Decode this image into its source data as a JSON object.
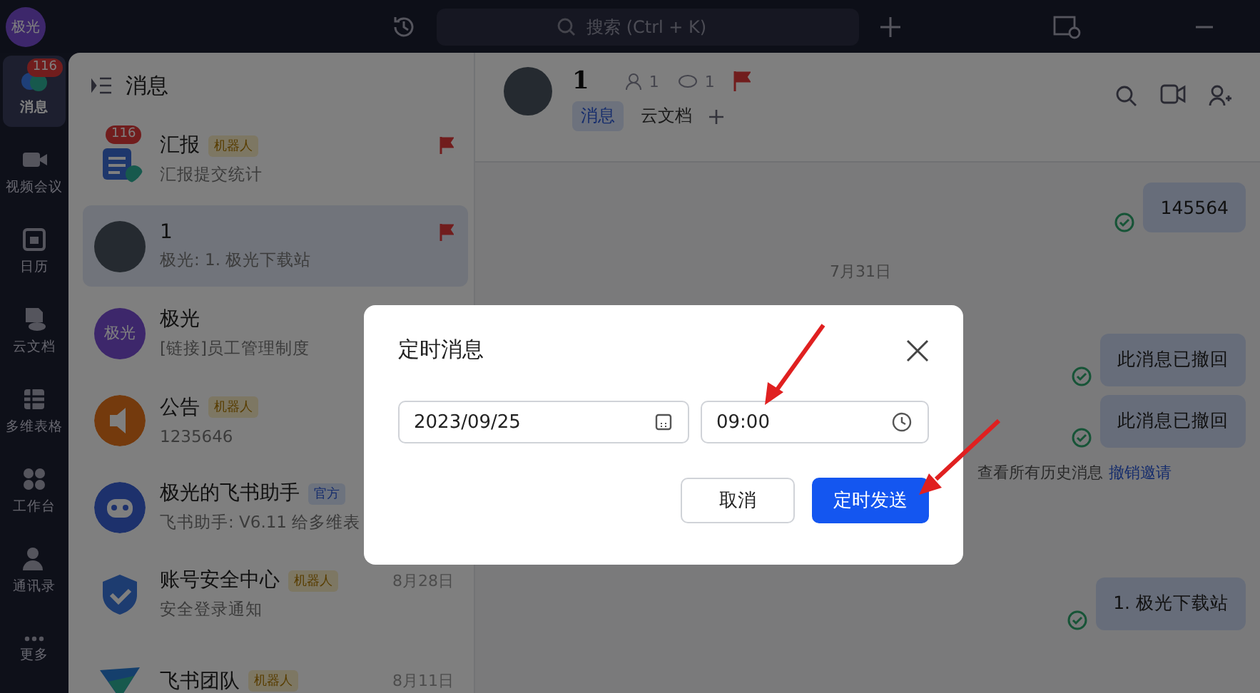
{
  "topbar": {
    "avatar": "极光",
    "search": {
      "placeholder": "搜索 (Ctrl + K)"
    }
  },
  "rail": [
    {
      "label": "消息",
      "kind": "chat",
      "badge": "116",
      "selected": true
    },
    {
      "label": "视频会议",
      "kind": "video",
      "selected": false
    },
    {
      "label": "日历",
      "kind": "calendar",
      "selected": false
    },
    {
      "label": "云文档",
      "kind": "doc",
      "selected": false
    },
    {
      "label": "多维表格",
      "kind": "table",
      "selected": false
    },
    {
      "label": "工作台",
      "kind": "grid",
      "selected": false
    },
    {
      "label": "通讯录",
      "kind": "contacts",
      "selected": false
    },
    {
      "label": "更多",
      "kind": "more",
      "selected": false
    }
  ],
  "chat_list": {
    "title": "消息",
    "items": [
      {
        "name": "汇报",
        "tag": {
          "text": "机器人",
          "kind": "bot"
        },
        "preview": "汇报提交统计",
        "badge": "116",
        "flagged": true,
        "kind": "report",
        "selected": false
      },
      {
        "name": "1",
        "preview": "极光: 1. 极光下载站",
        "flagged": true,
        "kind": "photo",
        "selected": true
      },
      {
        "name": "极光",
        "preview": "[链接]员工管理制度",
        "flagged": false,
        "kind": "text",
        "avatar_text": "极光",
        "selected": false
      },
      {
        "name": "公告",
        "tag": {
          "text": "机器人",
          "kind": "bot"
        },
        "preview": "1235646",
        "flagged": false,
        "kind": "speaker",
        "selected": false
      },
      {
        "name": "极光的飞书助手",
        "tag": {
          "text": "官方",
          "kind": "official"
        },
        "preview": "飞书助手: V6.11 给多维表",
        "flagged": false,
        "kind": "robot",
        "selected": false
      },
      {
        "name": "账号安全中心",
        "tag": {
          "text": "机器人",
          "kind": "bot"
        },
        "time": "8月28日",
        "preview": "安全登录通知",
        "flagged": false,
        "kind": "shield",
        "selected": false
      },
      {
        "name": "飞书团队",
        "tag": {
          "text": "机器人",
          "kind": "bot"
        },
        "time": "8月11日",
        "flagged": false,
        "kind": "team",
        "selected": false
      }
    ]
  },
  "chat": {
    "title": "1",
    "members": "1",
    "watchers": "1",
    "flagged": true,
    "tabs": [
      {
        "label": "消息",
        "selected": true
      },
      {
        "label": "云文档",
        "selected": false
      }
    ],
    "messages": [
      {
        "kind": "bubble",
        "text": "145564"
      },
      {
        "kind": "date",
        "text": "7月31日"
      },
      {
        "kind": "bubble",
        "text": "此消息已撤回"
      },
      {
        "kind": "bubble",
        "text": "此消息已撤回"
      },
      {
        "kind": "notice",
        "text": "查看所有历史消息",
        "link": "撤销邀请"
      },
      {
        "kind": "bubble",
        "text": "1. 极光下载站"
      }
    ]
  },
  "dialog": {
    "title": "定时消息",
    "date": "2023/09/25",
    "time": "09:00",
    "buttons": [
      {
        "label": "取消",
        "kind": "secondary"
      },
      {
        "label": "定时发送",
        "kind": "primary"
      }
    ]
  }
}
